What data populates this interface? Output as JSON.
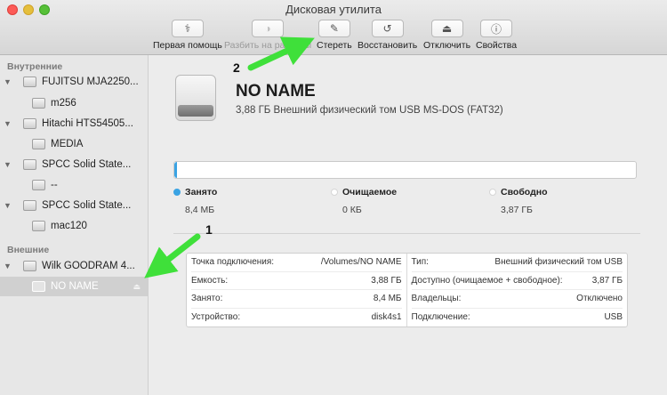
{
  "window": {
    "title": "Дисковая утилита"
  },
  "toolbar": {
    "first_aid": "Первая помощь",
    "partition": "Разбить на разделы",
    "erase": "Стереть",
    "restore": "Восстановить",
    "unmount": "Отключить",
    "info": "Свойства"
  },
  "sidebar": {
    "internal_header": "Внутренние",
    "external_header": "Внешние",
    "items": [
      {
        "label": "FUJITSU MJA2250..."
      },
      {
        "label": "m256"
      },
      {
        "label": "Hitachi HTS54505..."
      },
      {
        "label": "MEDIA"
      },
      {
        "label": "SPCC Solid State..."
      },
      {
        "label": "--"
      },
      {
        "label": "SPCC Solid State..."
      },
      {
        "label": "mac120"
      },
      {
        "label": "Wilk GOODRAM 4..."
      },
      {
        "label": "NO NAME"
      }
    ]
  },
  "volume": {
    "name": "NO NAME",
    "description": "3,88 ГБ Внешний физический том USB MS-DOS (FAT32)"
  },
  "usage": {
    "used_fraction": 0.002,
    "used_color": "#3aa3e3",
    "used_label": "Занято",
    "used_value": "8,4 МБ",
    "purgeable_label": "Очищаемое",
    "purgeable_value": "0 КБ",
    "free_label": "Свободно",
    "free_value": "3,87 ГБ"
  },
  "info": {
    "left": [
      {
        "key": "Точка подключения:",
        "value": "/Volumes/NO NAME"
      },
      {
        "key": "Емкость:",
        "value": "3,88 ГБ"
      },
      {
        "key": "Занято:",
        "value": "8,4 МБ"
      },
      {
        "key": "Устройство:",
        "value": "disk4s1"
      }
    ],
    "right": [
      {
        "key": "Тип:",
        "value": "Внешний физический том USB"
      },
      {
        "key": "Доступно (очищаемое + свободное):",
        "value": "3,87 ГБ"
      },
      {
        "key": "Владельцы:",
        "value": "Отключено"
      },
      {
        "key": "Подключение:",
        "value": "USB"
      }
    ]
  },
  "annotations": {
    "marker_1": "1",
    "marker_2": "2",
    "arrow_color": "#3fe03a"
  }
}
